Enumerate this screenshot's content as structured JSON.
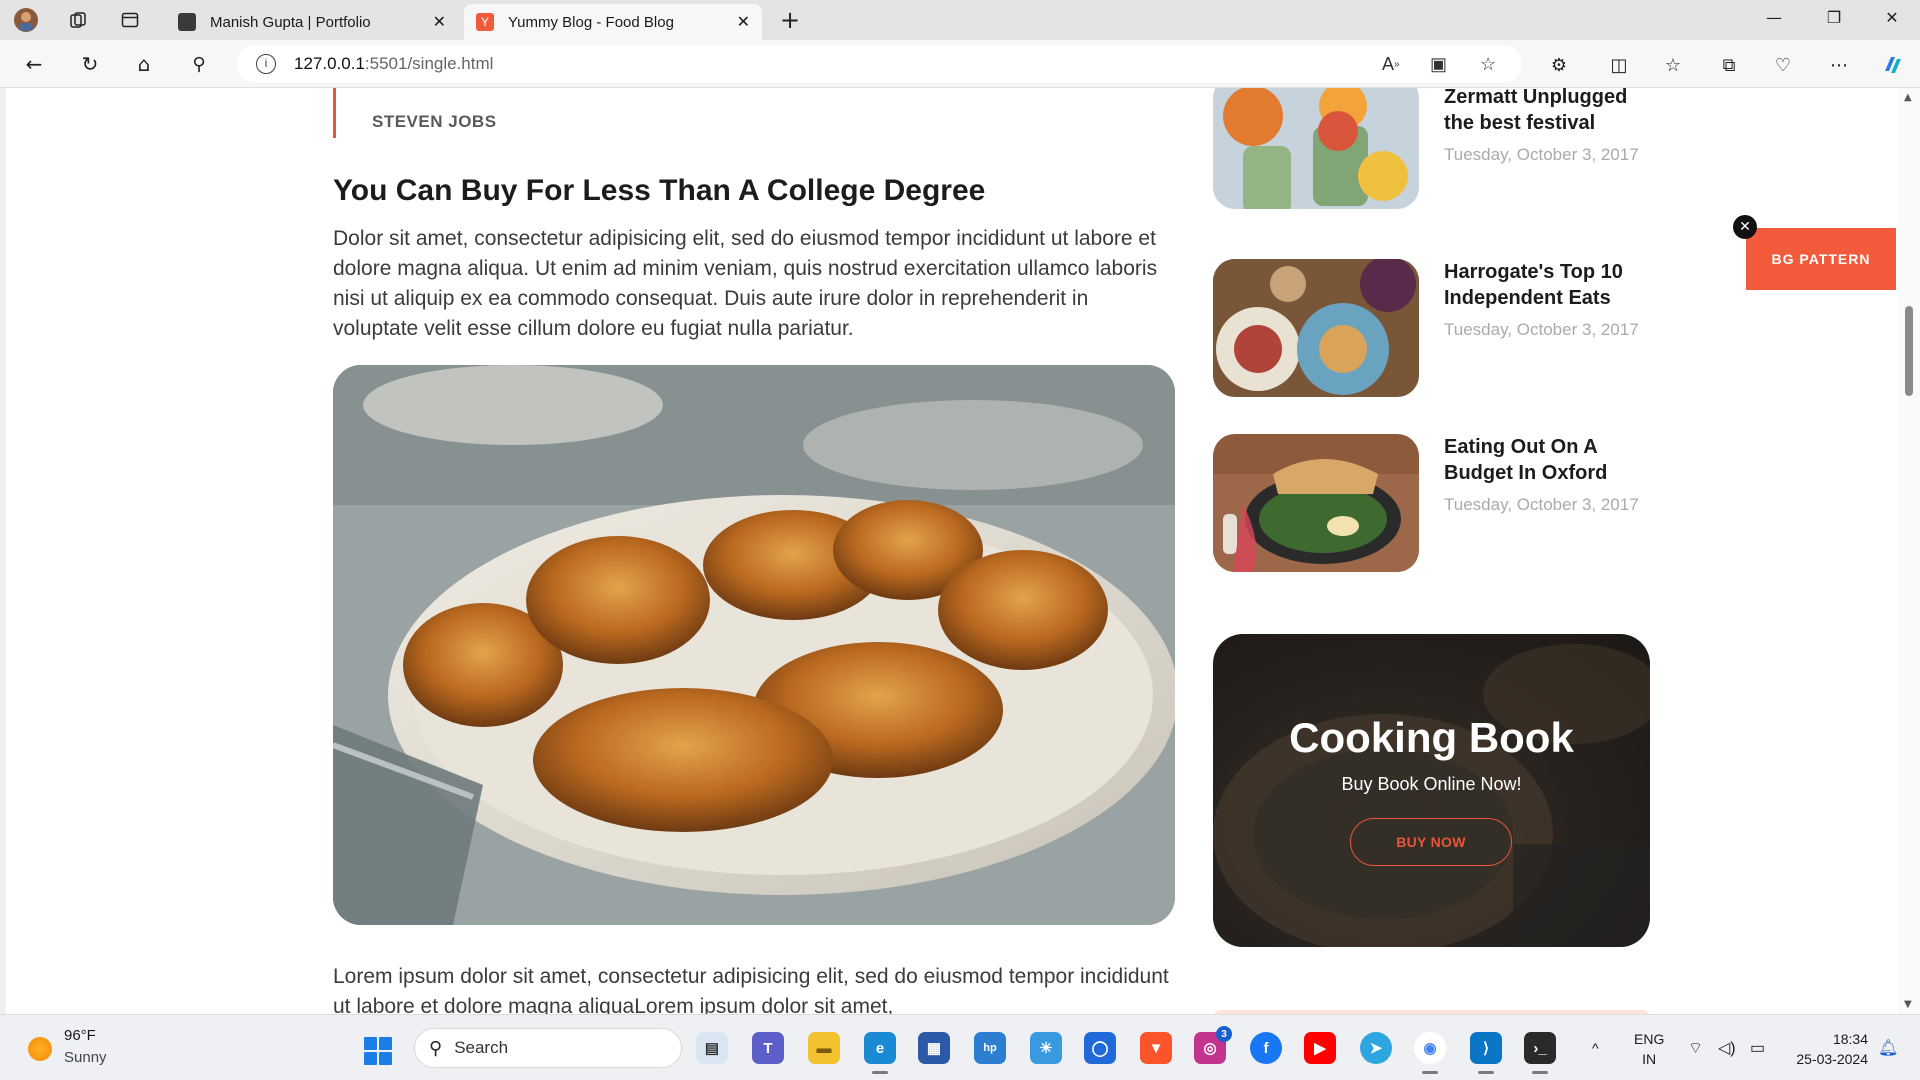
{
  "browser": {
    "tabs": [
      {
        "title": "Manish Gupta | Portfolio",
        "favicon_color": "#3a3a3a"
      },
      {
        "title": "Yummy Blog - Food Blog",
        "favicon_color": "#f15a3a"
      }
    ],
    "url_host": "127.0.0.1",
    "url_path": ":5501/single.html"
  },
  "post": {
    "quote_author": "STEVEN JOBS",
    "heading": "You Can Buy For Less Than A College Degree",
    "paragraph": "Dolor sit amet, consectetur adipisicing elit, sed do eiusmod tempor incididunt ut labore et dolore magna aliqua. Ut enim ad minim veniam, quis nostrud exercitation ullamco laboris nisi ut aliquip ex ea commodo consequat. Duis aute irure dolor in reprehenderit in voluptate velit esse cillum dolore eu fugiat nulla pariatur.",
    "paragraph2": "Lorem ipsum dolor sit amet, consectetur adipisicing elit, sed do eiusmod tempor incididunt ut labore et dolore magna aliquaLorem ipsum dolor sit amet,"
  },
  "sidebar": {
    "posts": [
      {
        "title": "Zermatt Unplugged the best festival",
        "date": "Tuesday, October 3, 2017"
      },
      {
        "title": "Harrogate's Top 10 Independent Eats",
        "date": "Tuesday, October 3, 2017"
      },
      {
        "title": "Eating Out On A Budget In Oxford",
        "date": "Tuesday, October 3, 2017"
      }
    ],
    "cooking_book": {
      "title": "Cooking Book",
      "subtitle": "Buy Book Online Now!",
      "button": "BUY NOW"
    }
  },
  "bg_pattern_label": "BG PATTERN",
  "taskbar": {
    "weather_temp": "96°F",
    "weather_cond": "Sunny",
    "search_placeholder": "Search",
    "instagram_badge": "3",
    "lang_top": "ENG",
    "lang_bottom": "IN",
    "time": "18:34",
    "date": "25-03-2024"
  },
  "colors": {
    "accent": "#f15a3a",
    "heading": "#1c1c1c",
    "date_gray": "#aaaaaa"
  }
}
